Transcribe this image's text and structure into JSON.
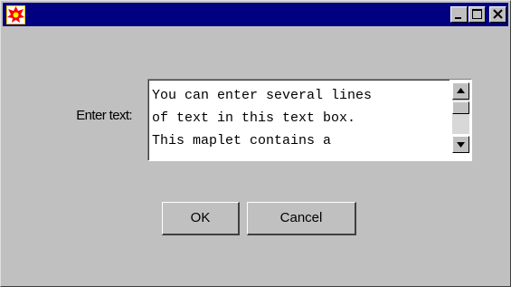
{
  "window": {
    "title": "",
    "controls": {
      "minimize": "minimize-icon",
      "maximize": "maximize-icon",
      "close": "close-icon"
    }
  },
  "form": {
    "label": "Enter text:",
    "textarea_lines": [
      "You can enter several lines",
      "of text in this text box.",
      "This maplet contains a"
    ]
  },
  "buttons": {
    "ok": "OK",
    "cancel": "Cancel"
  },
  "colors": {
    "titlebar": "#000080",
    "window_bg": "#c0c0c0"
  }
}
